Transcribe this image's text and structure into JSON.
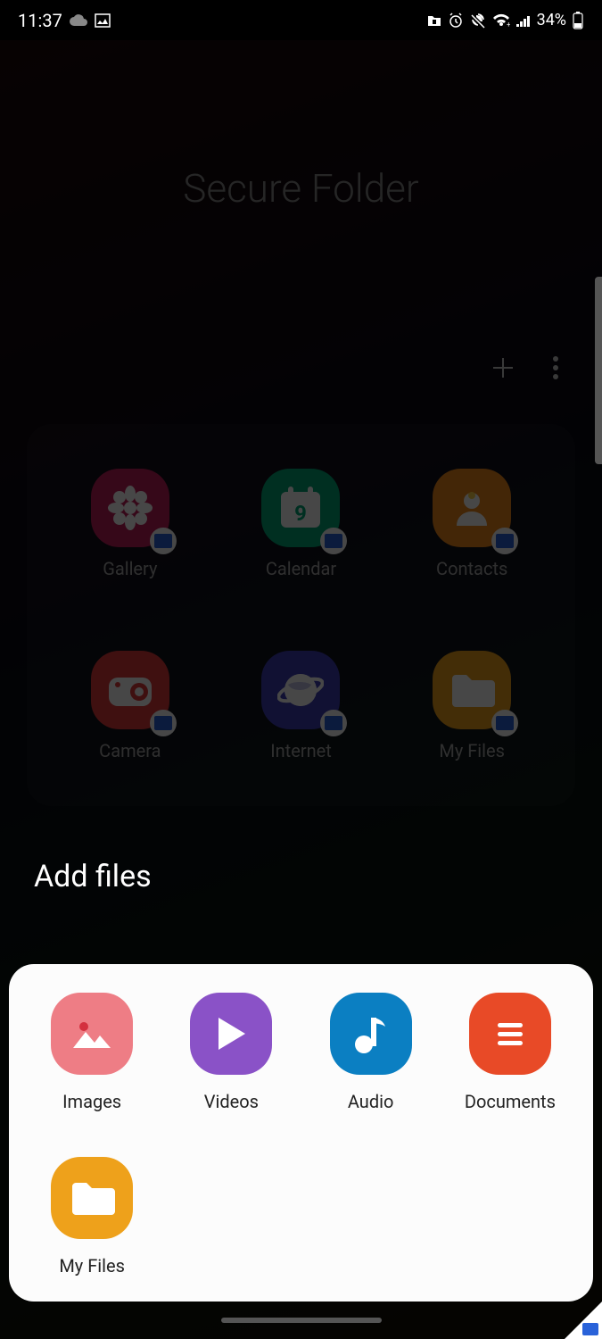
{
  "status": {
    "time": "11:37",
    "battery": "34%"
  },
  "page": {
    "title": "Secure Folder"
  },
  "apps": [
    {
      "label": "Gallery",
      "bg": "#c21e5b",
      "icon": "flower"
    },
    {
      "label": "Calendar",
      "bg": "#00a878",
      "icon": "calendar",
      "day": "9"
    },
    {
      "label": "Contacts",
      "bg": "#f08a1b",
      "icon": "contact"
    },
    {
      "label": "Camera",
      "bg": "#e03a3a",
      "icon": "camera"
    },
    {
      "label": "Internet",
      "bg": "#3d3db8",
      "icon": "planet"
    },
    {
      "label": "My Files",
      "bg": "#f0a01b",
      "icon": "folder"
    }
  ],
  "sheet": {
    "title": "Add files",
    "items": [
      {
        "label": "Images",
        "bg": "#ee7d85",
        "icon": "image"
      },
      {
        "label": "Videos",
        "bg": "#8a52c7",
        "icon": "play"
      },
      {
        "label": "Audio",
        "bg": "#0b7fc2",
        "icon": "note"
      },
      {
        "label": "Documents",
        "bg": "#e84a27",
        "icon": "doc"
      },
      {
        "label": "My Files",
        "bg": "#eea11b",
        "icon": "folder"
      }
    ]
  }
}
